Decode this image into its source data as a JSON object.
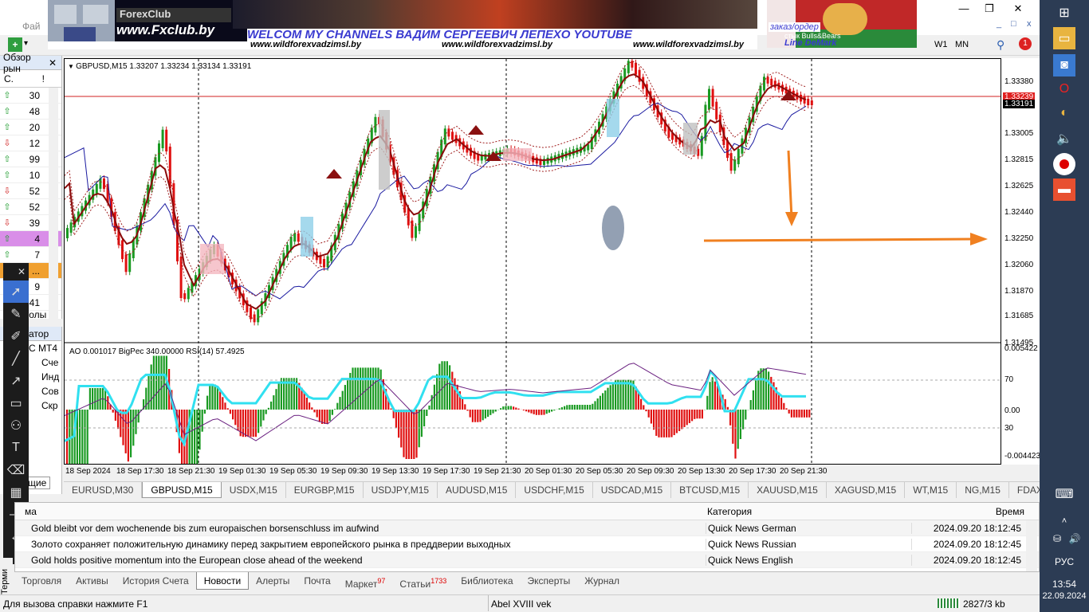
{
  "app": {
    "menu_first": "Фай",
    "winctl": {
      "min": "—",
      "restore": "❐",
      "close": "✕"
    },
    "inner_min": "_",
    "inner_max": "□",
    "inner_close": "x"
  },
  "banner": {
    "brand": "ForexClub",
    "url": "www.Fxclub.by",
    "headline": "WELCOM MY CHANNELS ВАДИМ СЕРГЕЕВИЧ ЛЕПЕХО YOUTUBE",
    "site1": "www.wildforexvadzimsl.by",
    "site2": "www.wildforexvadzimsl.by",
    "site3": "www.wildforexvadzimsl.by",
    "right1": "заказ/ордер",
    "right2": "стык Bulls&Bears",
    "right3": "Line DeMark"
  },
  "toolbar": {
    "tf_w1": "W1",
    "tf_mn": "MN",
    "alerts": "1"
  },
  "market_watch": {
    "title": "Обзор рын",
    "col1": "С.",
    "col2": "!",
    "rows": [
      {
        "dir": "up",
        "v": "30"
      },
      {
        "dir": "up",
        "v": "48"
      },
      {
        "dir": "up",
        "v": "20"
      },
      {
        "dir": "down",
        "v": "12"
      },
      {
        "dir": "up",
        "v": "99"
      },
      {
        "dir": "up",
        "v": "10"
      },
      {
        "dir": "down",
        "v": "52"
      },
      {
        "dir": "up",
        "v": "52"
      },
      {
        "dir": "down",
        "v": "39"
      },
      {
        "dir": "up",
        "v": "4"
      },
      {
        "dir": "up",
        "v": "7"
      },
      {
        "dir": "down",
        "v": "..."
      },
      {
        "dir": "up",
        "v": "9"
      },
      {
        "dir": "up",
        "v": "41"
      }
    ],
    "symbols_tab": "волы"
  },
  "navigator": {
    "title": "атор",
    "root": "С MT4",
    "items": [
      "Сче",
      "Инд",
      "Сов",
      "Скр"
    ],
    "bottom_tab": "щие"
  },
  "chart": {
    "header": "GBPUSD,M15  1.33207 1.33234 1.33134 1.33191",
    "sub_header": "AO 0.001017  BigPec 340.00000  RSI(14) 57.4925",
    "price_labels": [
      "1.33380",
      "1.33005",
      "1.32815",
      "1.32625",
      "1.32440",
      "1.32250",
      "1.32060",
      "1.31870",
      "1.31685",
      "1.31495"
    ],
    "price_red": "1.33239",
    "price_current": "1.33191",
    "sub_labels": [
      "0.005422",
      "70",
      "0.00",
      "30",
      "-0.004423"
    ],
    "time_labels": [
      "18 Sep 2024",
      "18 Sep 17:30",
      "18 Sep 21:30",
      "19 Sep 01:30",
      "19 Sep 05:30",
      "19 Sep 09:30",
      "19 Sep 13:30",
      "19 Sep 17:30",
      "19 Sep 21:30",
      "20 Sep 01:30",
      "20 Sep 05:30",
      "20 Sep 09:30",
      "20 Sep 13:30",
      "20 Sep 17:30",
      "20 Sep 21:30"
    ]
  },
  "symbol_tabs": [
    {
      "label": "EURUSD,M30",
      "active": false
    },
    {
      "label": "GBPUSD,M15",
      "active": true
    },
    {
      "label": "USDX,M15",
      "active": false
    },
    {
      "label": "EURGBP,M15",
      "active": false
    },
    {
      "label": "USDJPY,M15",
      "active": false
    },
    {
      "label": "AUDUSD,M15",
      "active": false
    },
    {
      "label": "USDCHF,M15",
      "active": false
    },
    {
      "label": "USDCAD,M15",
      "active": false
    },
    {
      "label": "BTCUSD,M15",
      "active": false
    },
    {
      "label": "XAUUSD,M15",
      "active": false
    },
    {
      "label": "XAGUSD,M15",
      "active": false
    },
    {
      "label": "WT,M15",
      "active": false
    },
    {
      "label": "NG,M15",
      "active": false
    },
    {
      "label": "FDAX,M",
      "active": false
    }
  ],
  "terminal": {
    "side_label": "Терми",
    "columns": {
      "subject": "ма",
      "category": "Категория",
      "time": "Время"
    },
    "rows": [
      {
        "subject": "Gold bleibt vor dem wochenende bis zum europaischen borsenschluss im aufwind",
        "category": "Quick News German",
        "time": "2024.09.20 18:12:45"
      },
      {
        "subject": "Золото сохраняет положительную динамику перед закрытием европейского рынка в преддверии выходных",
        "category": "Quick News Russian",
        "time": "2024.09.20 18:12:45"
      },
      {
        "subject": "Gold holds positive momentum into the European close ahead of the weekend",
        "category": "Quick News English",
        "time": "2024.09.20 18:12:45"
      }
    ],
    "tabs": [
      {
        "label": "Торговля",
        "badge": ""
      },
      {
        "label": "Активы",
        "badge": ""
      },
      {
        "label": "История Счета",
        "badge": ""
      },
      {
        "label": "Новости",
        "badge": "",
        "active": true
      },
      {
        "label": "Алерты",
        "badge": ""
      },
      {
        "label": "Почта",
        "badge": ""
      },
      {
        "label": "Маркет",
        "badge": "97"
      },
      {
        "label": "Статьи",
        "badge": "1733"
      },
      {
        "label": "Библиотека",
        "badge": ""
      },
      {
        "label": "Эксперты",
        "badge": ""
      },
      {
        "label": "Журнал",
        "badge": ""
      }
    ]
  },
  "status": {
    "help": "Для вызова справки нажмите F1",
    "profile": "Abel XVIII vek",
    "traffic": "2827/3 kb"
  },
  "taskbar": {
    "lang": "РУС",
    "time": "13:54",
    "date": "22.09.2024"
  }
}
